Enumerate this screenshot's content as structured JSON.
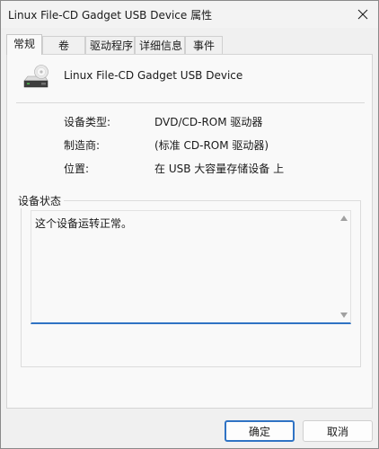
{
  "window": {
    "title": "Linux File-CD Gadget USB Device 属性"
  },
  "tabs": [
    {
      "label": "常规"
    },
    {
      "label": "卷"
    },
    {
      "label": "驱动程序"
    },
    {
      "label": "详细信息"
    },
    {
      "label": "事件"
    }
  ],
  "device": {
    "name": "Linux File-CD Gadget USB Device",
    "icon": "optical-drive-icon"
  },
  "properties": [
    {
      "label": "设备类型:",
      "value": "DVD/CD-ROM 驱动器"
    },
    {
      "label": "制造商:",
      "value": "(标准 CD-ROM 驱动器)"
    },
    {
      "label": "位置:",
      "value": "在 USB 大容量存储设备 上"
    }
  ],
  "status": {
    "group_label": "设备状态",
    "text": "这个设备运转正常。"
  },
  "buttons": {
    "ok": "确定",
    "cancel": "取消"
  },
  "colors": {
    "accent": "#2f73c4"
  }
}
